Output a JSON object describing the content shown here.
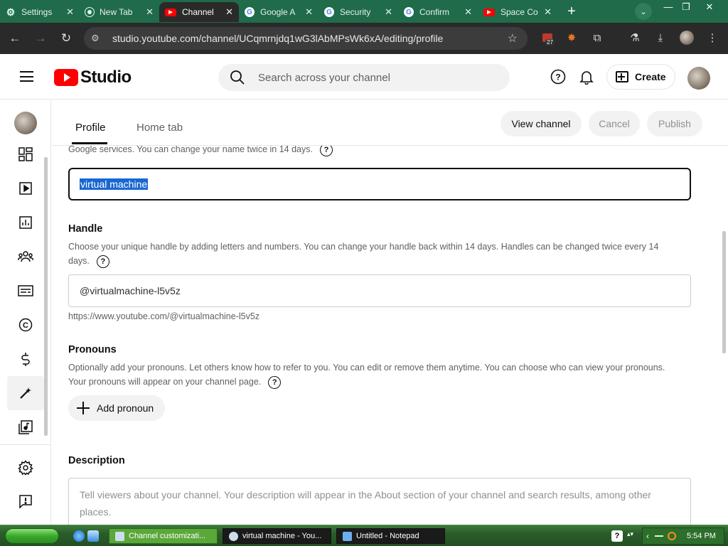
{
  "browser": {
    "tabs": [
      {
        "label": "Settings",
        "icon": "gear-icon",
        "active": false
      },
      {
        "label": "New Tab",
        "icon": "chrome-icon",
        "active": false
      },
      {
        "label": "Channel",
        "icon": "youtube-icon",
        "active": true
      },
      {
        "label": "Google A",
        "icon": "google-icon",
        "active": false
      },
      {
        "label": "Security",
        "icon": "google-icon",
        "active": false
      },
      {
        "label": "Confirm",
        "icon": "google-icon",
        "active": false
      },
      {
        "label": "Space Co",
        "icon": "youtube-icon",
        "active": false
      }
    ],
    "url": "studio.youtube.com/channel/UCqmrnjdq1wG3lAbMPsWk6xA/editing/profile",
    "extension_badge": "27"
  },
  "header": {
    "logo_text": "Studio",
    "search_placeholder": "Search across your channel",
    "create_label": "Create"
  },
  "subnav": {
    "tabs": [
      "Profile",
      "Home tab"
    ],
    "active_tab": "Profile",
    "view_channel_label": "View channel",
    "cancel_label": "Cancel",
    "publish_label": "Publish"
  },
  "name_section": {
    "help_text": "Google services. You can change your name twice in 14 days.",
    "value": "virtual machine"
  },
  "handle_section": {
    "title": "Handle",
    "help_text_1": "Choose your unique handle by adding letters and numbers. You can change your handle back within 14 days. Handles can be changed twice every 14",
    "help_text_2": "days.",
    "value": "@virtualmachine-l5v5z",
    "url": "https://www.youtube.com/@virtualmachine-l5v5z"
  },
  "pronouns_section": {
    "title": "Pronouns",
    "help_text_1": "Optionally add your pronouns. Let others know how to refer to you. You can edit or remove them anytime. You can choose who can view your pronouns.",
    "help_text_2": "Your pronouns will appear on your channel page.",
    "add_label": "Add pronoun"
  },
  "description_section": {
    "title": "Description",
    "placeholder": "Tell viewers about your channel. Your description will appear in the About section of your channel and search results, among other places."
  },
  "taskbar": {
    "windows": [
      {
        "label": "Channel customizati...",
        "active": true
      },
      {
        "label": "virtual machine - You...",
        "active": false
      },
      {
        "label": "Untitled - Notepad",
        "active": false
      }
    ],
    "clock": "5:54 PM"
  }
}
